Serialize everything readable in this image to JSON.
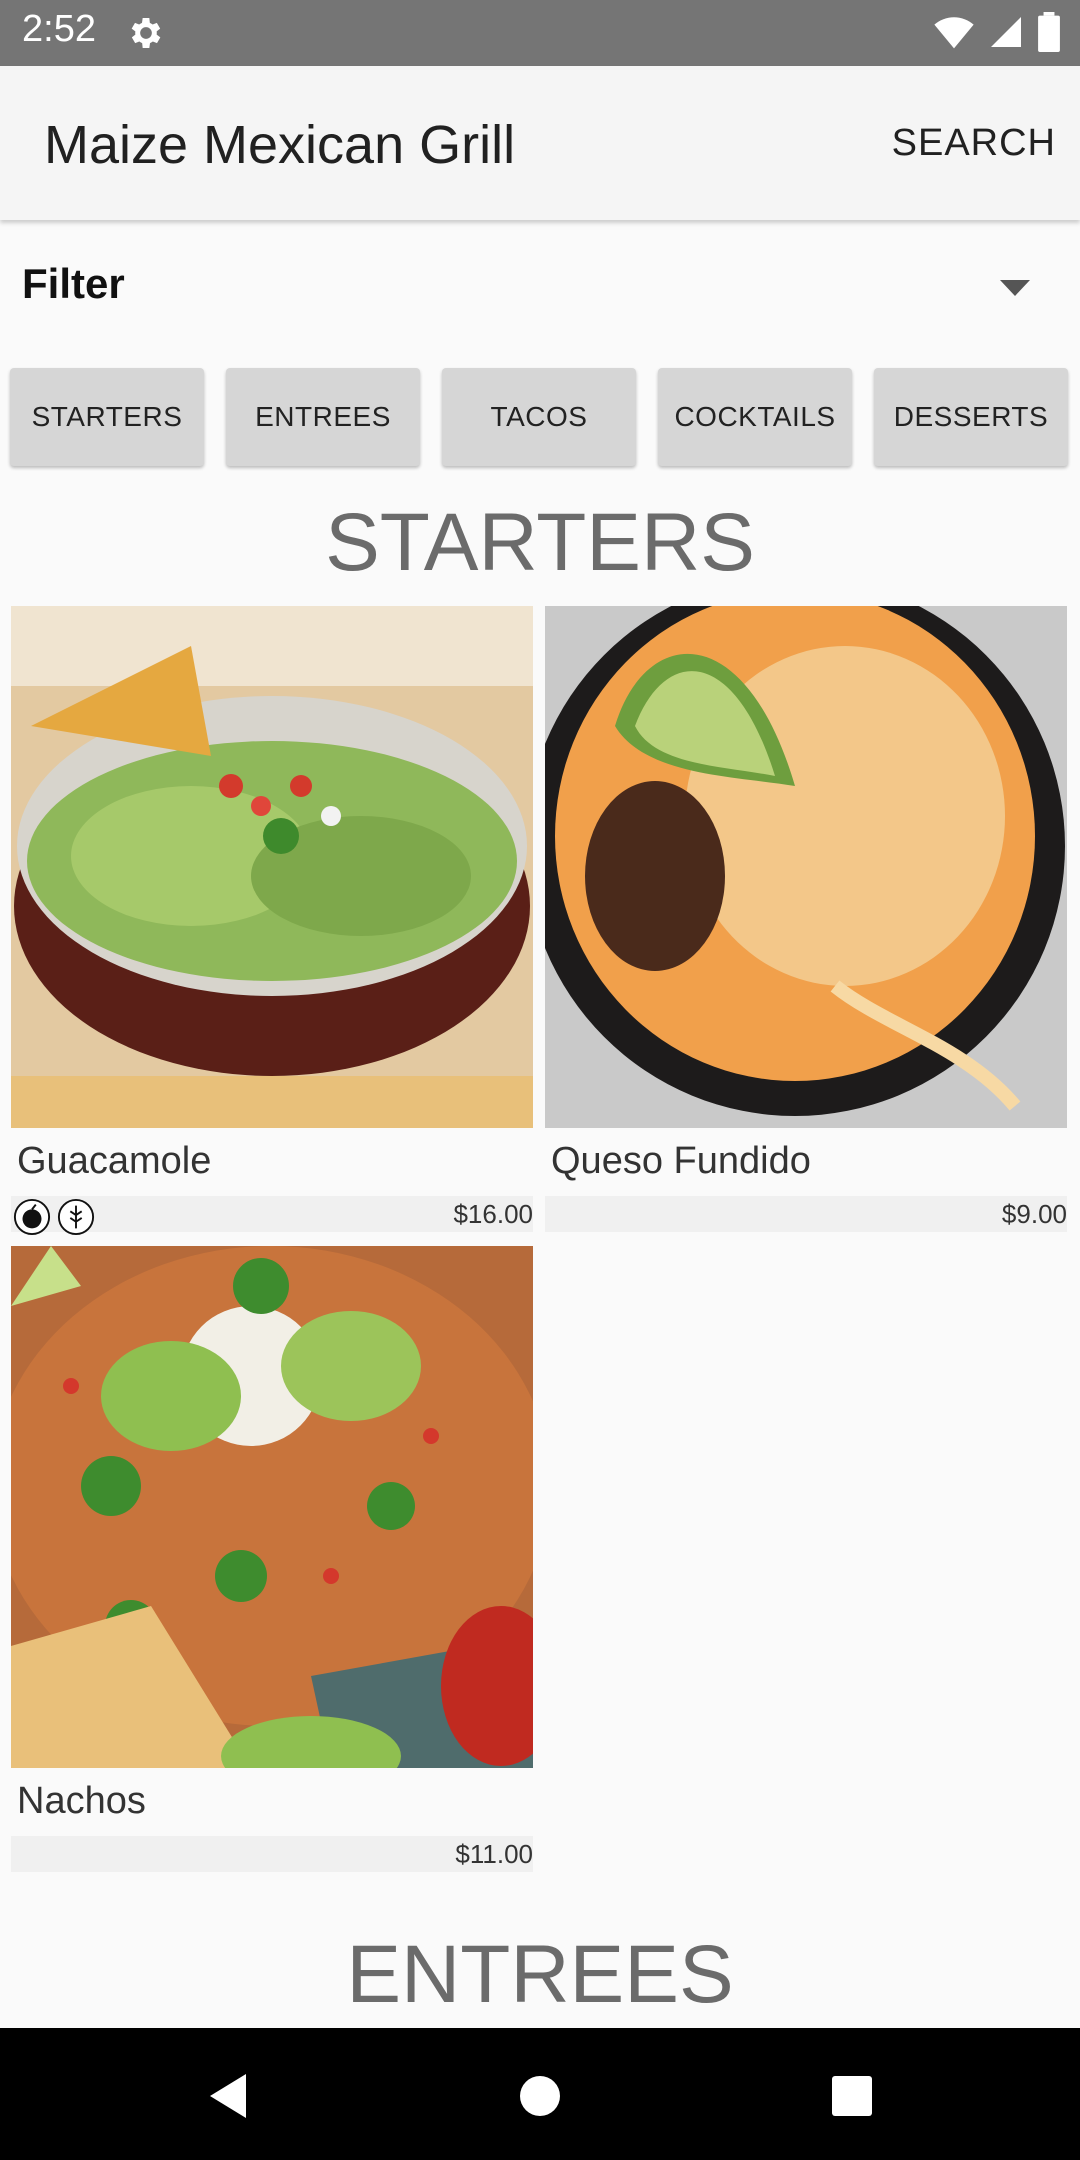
{
  "status_bar": {
    "time": "2:52",
    "icons": [
      "gear-icon",
      "wifi-icon",
      "signal-icon",
      "battery-icon"
    ]
  },
  "app_bar": {
    "title": "Maize Mexican Grill",
    "search_label": "SEARCH"
  },
  "filter": {
    "label": "Filter"
  },
  "categories": [
    "STARTERS",
    "ENTREES",
    "TACOS",
    "COCKTAILS",
    "DESSERTS"
  ],
  "sections": [
    {
      "title": "STARTERS",
      "items": [
        {
          "name": "Guacamole",
          "price": "$16.00",
          "badges": [
            "vegan-icon",
            "gluten-free-icon"
          ]
        },
        {
          "name": "Queso Fundido",
          "price": "$9.00",
          "badges": []
        },
        {
          "name": "Nachos",
          "price": "$11.00",
          "badges": []
        }
      ]
    },
    {
      "title": "ENTREES",
      "items": []
    }
  ],
  "colors": {
    "status_bar": "#757575",
    "app_bar": "#f5f5f5",
    "category_button": "#d6d6d6",
    "section_title": "#6b6b6b",
    "nav_bar": "#000000"
  },
  "nav": [
    "back-icon",
    "home-icon",
    "recents-icon"
  ]
}
